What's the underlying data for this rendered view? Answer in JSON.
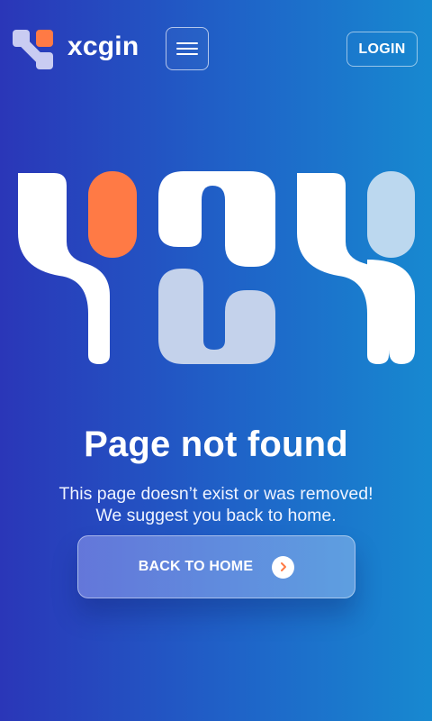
{
  "header": {
    "brand_name": "xcgin",
    "login_label": "LOGIN"
  },
  "error": {
    "code": "404",
    "title": "Page not found",
    "description_lines": [
      "This page doesn’t exist or was removed!",
      "We suggest you back to home."
    ]
  },
  "cta": {
    "label": "BACK TO HOME"
  },
  "colors": {
    "accent": "#ff7a45",
    "light_blue": "#bcd8ef",
    "pale_blue": "#c4d2eb",
    "logo_violet": "#c9ccf2"
  },
  "icons": {
    "logo": "brand-logo-mark",
    "menu": "hamburger-icon",
    "cta": "chevron-right-icon"
  }
}
